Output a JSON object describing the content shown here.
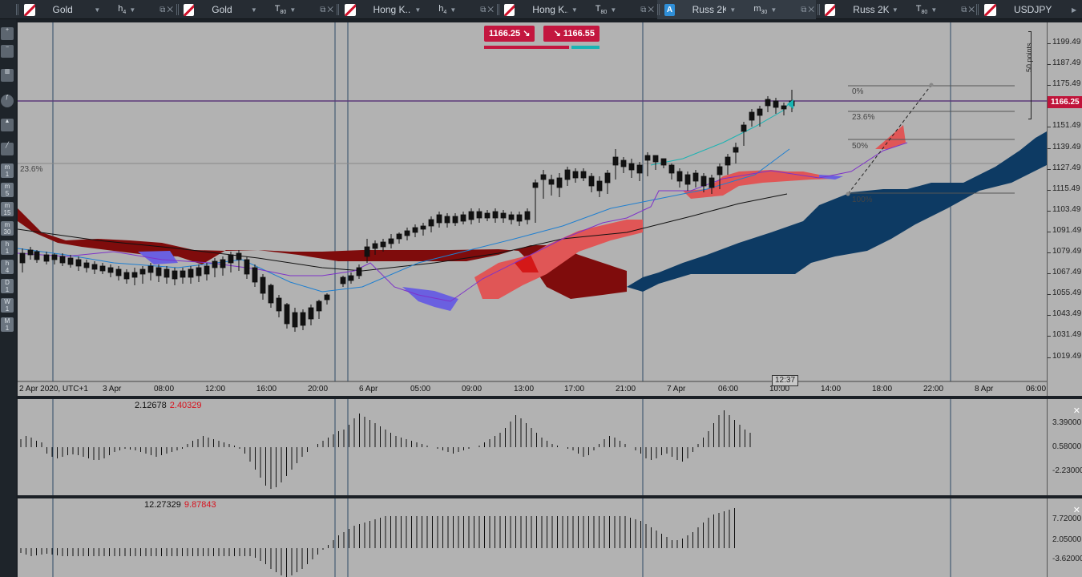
{
  "tabs": [
    {
      "icon": "gold-symbol-icon",
      "name": "Gold",
      "timeframe": "h",
      "tf_sub": "4"
    },
    {
      "icon": "gold-symbol-icon",
      "name": "Gold",
      "timeframe": "T",
      "tf_sub": "80"
    },
    {
      "icon": "hk-symbol-icon",
      "name": "Hong K...",
      "timeframe": "h",
      "tf_sub": "4"
    },
    {
      "icon": "hk-symbol-icon",
      "name": "Hong K...",
      "timeframe": "T",
      "tf_sub": "80"
    },
    {
      "icon": "A",
      "name": "Russ 2K",
      "timeframe": "m",
      "tf_sub": "30",
      "active": true
    },
    {
      "icon": "russ-symbol-icon",
      "name": "Russ 2K",
      "timeframe": "T",
      "tf_sub": "80"
    },
    {
      "icon": "usdjpy-symbol-icon",
      "name": "USDJPY",
      "timeframe": "",
      "tf_sub": ""
    }
  ],
  "left_toolbar": {
    "timeframes": [
      {
        "top": "m",
        "bot": "1"
      },
      {
        "top": "m",
        "bot": "5"
      },
      {
        "top": "m",
        "bot": "15"
      },
      {
        "top": "m",
        "bot": "30"
      },
      {
        "top": "h",
        "bot": "1"
      },
      {
        "top": "h",
        "bot": "4"
      },
      {
        "top": "D",
        "bot": "1"
      },
      {
        "top": "W",
        "bot": "1"
      },
      {
        "top": "M",
        "bot": "1"
      }
    ]
  },
  "quote_bar": {
    "bid": "1166.25",
    "ask": "1166.55"
  },
  "price_axis": {
    "ticks": [
      "1199.49",
      "1187.49",
      "1175.49",
      "1163.49",
      "1151.49",
      "1139.49",
      "1127.49",
      "1115.49",
      "1103.49",
      "1091.49",
      "1079.49",
      "1067.49",
      "1055.49",
      "1043.49",
      "1031.49",
      "1019.49"
    ],
    "current_price": "1166.25",
    "range_label": "50 points"
  },
  "time_axis": {
    "labels": [
      "2 Apr 2020, UTC+1",
      "3 Apr",
      "08:00",
      "12:00",
      "16:00",
      "20:00",
      "6 Apr",
      "05:00",
      "09:00",
      "13:00",
      "17:00",
      "21:00",
      "7 Apr",
      "06:00",
      "10:00",
      "14:00",
      "18:00",
      "22:00",
      "8 Apr",
      "06:00"
    ],
    "cursor_time": "12:37"
  },
  "fibonacci": {
    "levels": [
      "0%",
      "23.6%",
      "50%",
      "100%"
    ],
    "left_label": "23.6%"
  },
  "oscillator1": {
    "value1": "2.12678",
    "value2": "2.40329",
    "ticks": [
      "3.39000",
      "0.58000",
      "-2.23000"
    ]
  },
  "oscillator2": {
    "value1": "12.27329",
    "value2": "9.87843",
    "ticks": [
      "7.72000",
      "2.05000",
      "-3.62000"
    ]
  },
  "colors": {
    "accent_red": "#c3163f",
    "cloud_bull": "#0d3a63",
    "cloud_bear": "#7a0a0a",
    "teal": "#19b3b3"
  }
}
